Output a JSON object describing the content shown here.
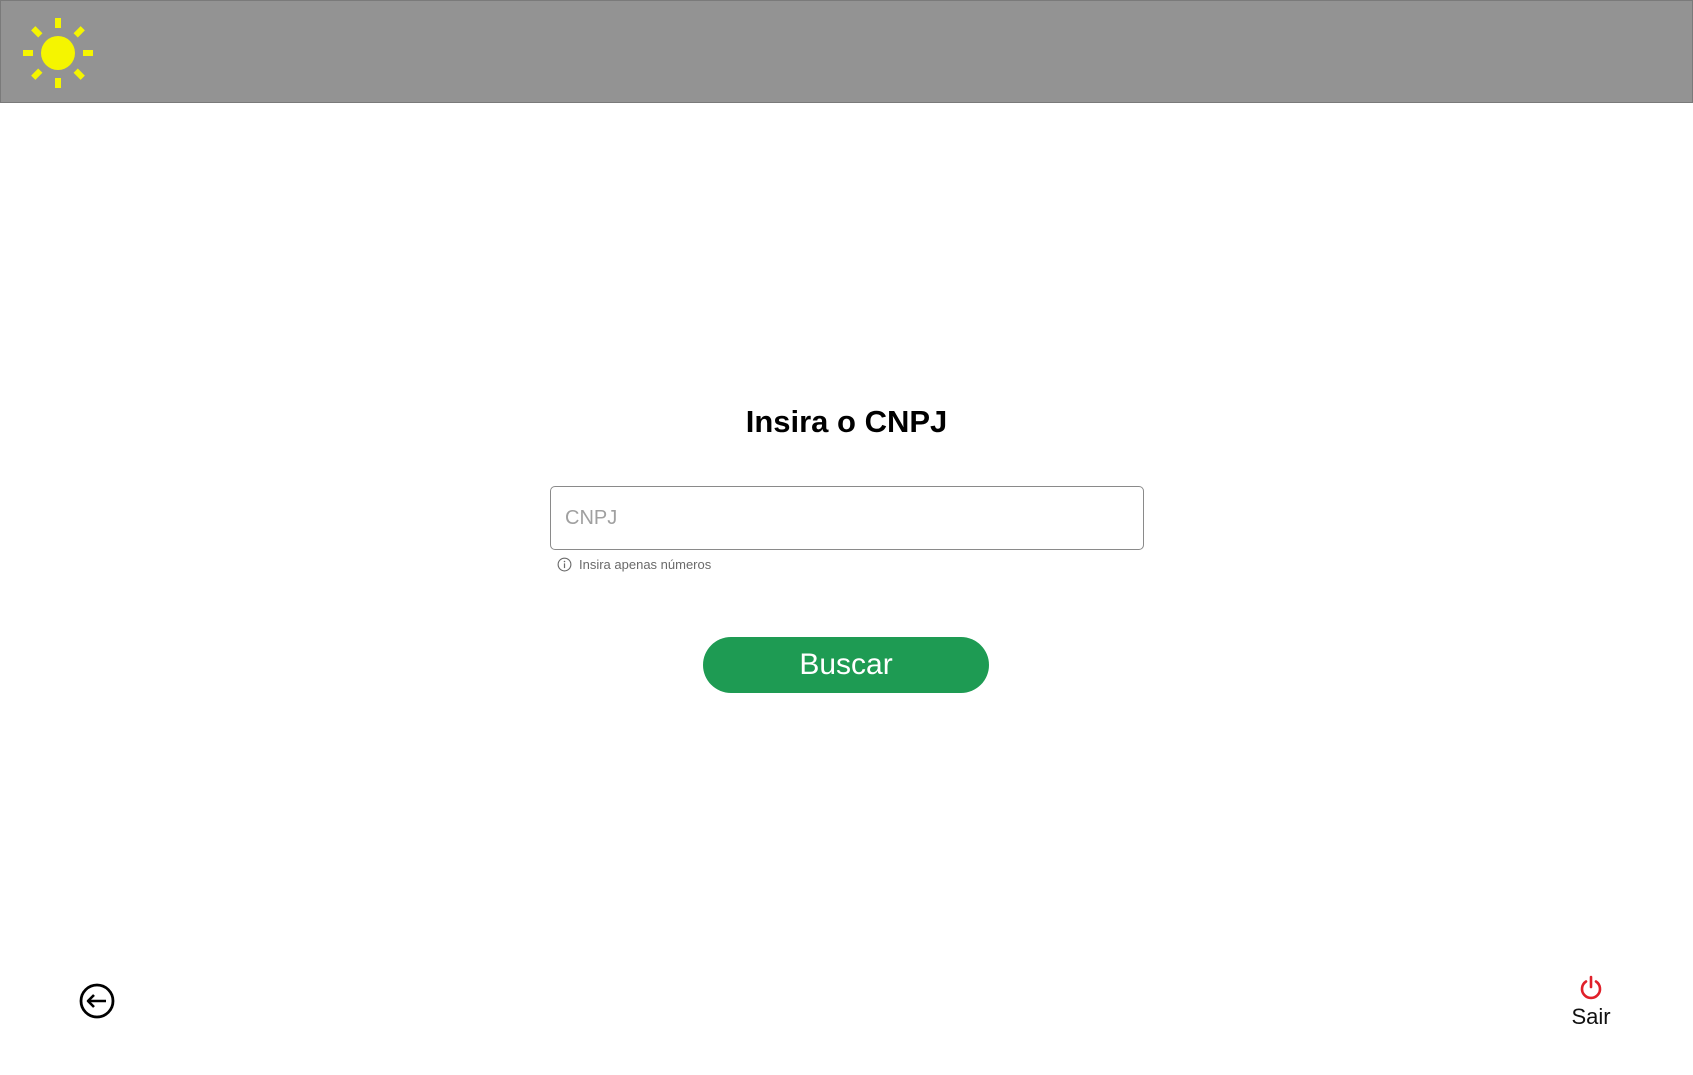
{
  "header": {
    "logo_icon": "sun-icon",
    "background_color": "#939393",
    "logo_color": "#f5f500"
  },
  "main": {
    "title": "Insira o CNPJ",
    "cnpj_input": {
      "placeholder": "CNPJ",
      "value": ""
    },
    "hint": {
      "icon": "info-icon",
      "text": "Insira apenas números"
    },
    "buscar_label": "Buscar",
    "buscar_color": "#1e9b53"
  },
  "footer": {
    "back_icon": "arrow-left-circle-icon",
    "logout_icon": "power-icon",
    "logout_label": "Sair",
    "logout_icon_color": "#e0202a"
  }
}
